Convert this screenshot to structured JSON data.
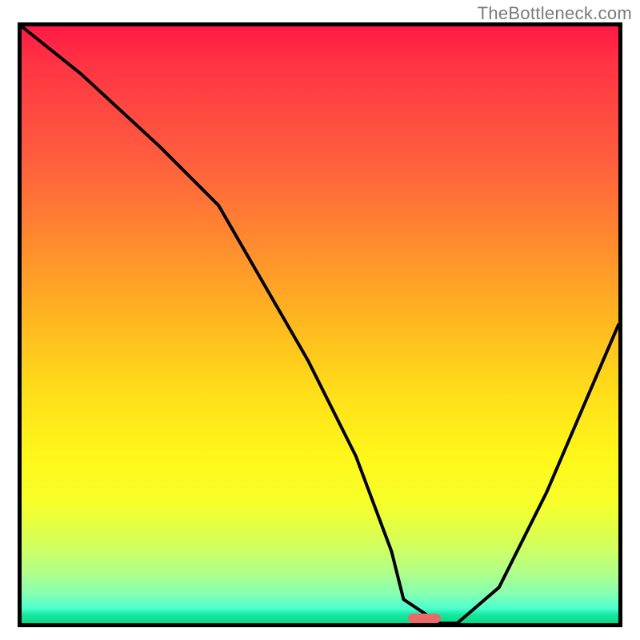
{
  "watermark": "TheBottleneck.com",
  "chart_data": {
    "type": "line",
    "title": "",
    "xlabel": "",
    "ylabel": "",
    "xlim": [
      0,
      100
    ],
    "ylim": [
      0,
      100
    ],
    "grid": false,
    "background_gradient": {
      "top": "#ff1a44",
      "mid": "#ffe019",
      "bottom": "#0cd787"
    },
    "series": [
      {
        "name": "bottleneck-curve",
        "color": "#000000",
        "x": [
          0,
          10,
          23,
          33,
          48,
          56,
          62,
          64,
          70,
          73,
          80,
          88,
          97,
          100
        ],
        "y": [
          100,
          92,
          80,
          70,
          44,
          28,
          12,
          4,
          0,
          0,
          6,
          22,
          43,
          50
        ]
      }
    ],
    "marker": {
      "name": "optimal-range",
      "x_center": 67.5,
      "y_center": 0.8,
      "width_pct": 5.5,
      "height_pct": 1.6,
      "color": "#e86a6a"
    }
  }
}
